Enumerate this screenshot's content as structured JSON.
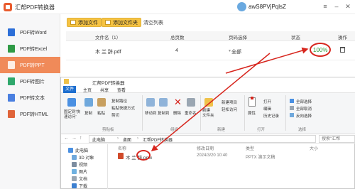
{
  "app": {
    "title": "汇帮PDF转换器",
    "user": "awS8PVjPqlsZ"
  },
  "sidebar": {
    "items": [
      {
        "label": "PDF转Word",
        "color": "#2d6fd8"
      },
      {
        "label": "PDF转Excel",
        "color": "#2f9a46"
      },
      {
        "label": "PDF转PPT",
        "color": "#e0643a",
        "active": true
      },
      {
        "label": "PDF转图片",
        "color": "#2fa86c"
      },
      {
        "label": "PDF转文本",
        "color": "#4a7fe0"
      },
      {
        "label": "PDF转HTML",
        "color": "#e0643a"
      }
    ]
  },
  "toolbar": {
    "add_file": "添加文件",
    "add_folder": "添加文件夹",
    "clear": "清空列表"
  },
  "table": {
    "headers": [
      "文件名（1）",
      "总页数",
      "页码选择",
      "状态",
      "操作"
    ],
    "row": {
      "name": "木 兰 辞.pdf",
      "pages": "4",
      "page_select": "全部",
      "status": "100%"
    }
  },
  "explorer": {
    "title": "汇帮PDF转换器",
    "tabs": [
      "文件",
      "主页",
      "共享",
      "查看"
    ],
    "ribbon": {
      "pin": "固定到'快\n速访问'",
      "copy": "复制",
      "paste": "粘贴",
      "copy_path": "复制路径",
      "paste_shortcut": "粘贴快捷方式",
      "cut": "剪切",
      "move_to": "移动到",
      "copy_to": "复制到",
      "delete": "删除",
      "rename": "重命名",
      "new_folder": "新建\n文件夹",
      "new_item": "新建项目",
      "easy_access": "轻松访问",
      "properties": "属性",
      "open": "打开",
      "edit": "编辑",
      "history": "历史记录",
      "select_all": "全部选择",
      "select_none": "全部取消",
      "invert": "反向选择",
      "groups": {
        "clipboard": "剪贴板",
        "organize": "组织",
        "new": "新建",
        "open": "打开",
        "select": "选择"
      }
    },
    "path": [
      "此电脑",
      "桌面",
      "汇帮PDF转换器"
    ],
    "search_placeholder": "搜索\"汇帮",
    "nav": [
      "此电脑",
      "3D 对象",
      "视频",
      "图片",
      "文档",
      "下载"
    ],
    "columns": [
      "名称",
      "修改日期",
      "类型",
      "大小"
    ],
    "file": {
      "name": "木 兰 辞.pptx",
      "date": "2024/3/20 10:40",
      "type": "PPTX 演示文稿"
    }
  },
  "colors": {
    "accent": "#f08a59",
    "button": "#f6c342",
    "annotation": "#d7261e",
    "success": "#2c9a3a"
  }
}
